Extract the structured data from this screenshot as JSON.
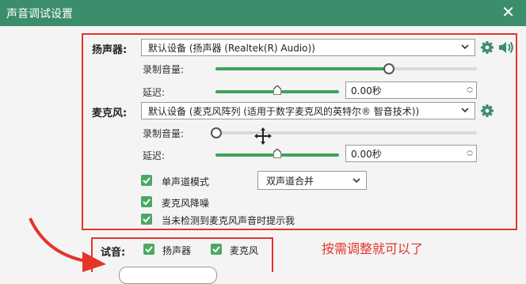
{
  "window": {
    "title": "声音调试设置"
  },
  "speaker": {
    "label": "扬声器:",
    "device": "默认设备 (扬声器 (Realtek(R) Audio))",
    "volume_label": "录制音量:",
    "volume_fraction": 0.66,
    "delay_label": "延迟:",
    "delay_value": "0.00秒"
  },
  "microphone": {
    "label": "麦克风:",
    "device": "默认设备 (麦克风阵列 (适用于数字麦克风的英特尔® 智音技术))",
    "volume_label": "录制音量:",
    "volume_fraction": 0.0,
    "delay_label": "延迟:",
    "delay_value": "0.00秒",
    "mono_label": "单声道模式",
    "mono_option": "双声道合并",
    "noise_label": "麦克风降噪",
    "notify_label": "当未检测到麦克风声音时提示我"
  },
  "test": {
    "label": "试音:",
    "speaker_label": "扬声器",
    "mic_label": "麦克风"
  },
  "annotation": "按需调整就可以了",
  "colors": {
    "titlebar": "#3c8d6b",
    "accent": "#4aa963",
    "annotation": "#e5342a"
  },
  "icons": [
    "close-icon",
    "gear-icon",
    "speaker-icon",
    "chevron-down-icon",
    "move-cursor-icon",
    "checkmark-icon",
    "arrow-icon"
  ]
}
